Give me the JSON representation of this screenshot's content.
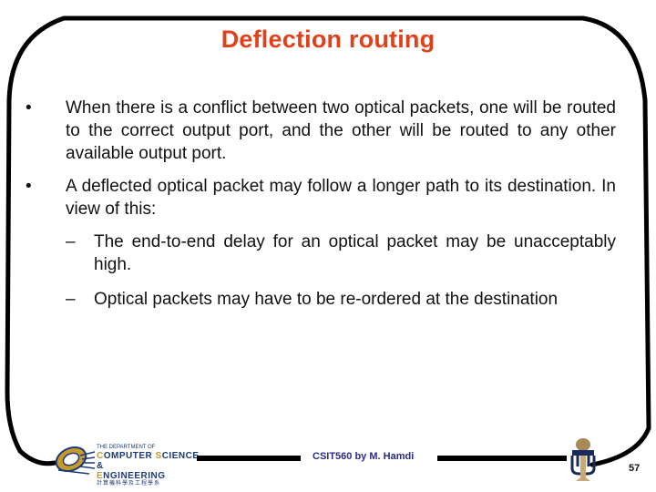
{
  "slide": {
    "title": "Deflection routing",
    "bullets": [
      {
        "marker": "•",
        "text": "When there is a conflict between two optical packets, one will be routed to the correct output port, and the other will be routed to any other available output port."
      },
      {
        "marker": "•",
        "text": "A deflected optical packet may follow a longer path to its destination. In view of this:"
      }
    ],
    "sub_bullets": [
      {
        "marker": "–",
        "text": "The end-to-end delay for an optical packet may be unacceptably high."
      },
      {
        "marker": "–",
        "text": "Optical packets may have to be re-ordered at the destination"
      }
    ]
  },
  "footer": {
    "department_logo": {
      "line1": "THE DEPARTMENT OF",
      "line2_c": "C",
      "line2_rest": "OMPUTER ",
      "line2_s": "S",
      "line2_rest2": "CIENCE &",
      "line3_e": "E",
      "line3_rest": "NGINEERING",
      "line4": "計算機科學及工程學系"
    },
    "author": "CSIT560 by M. Hamdi",
    "page_number": "57"
  },
  "colors": {
    "title": "#e0401a",
    "author": "#2a2a8a",
    "logo_blue": "#1a3a7a",
    "logo_gold": "#c89a2a"
  }
}
